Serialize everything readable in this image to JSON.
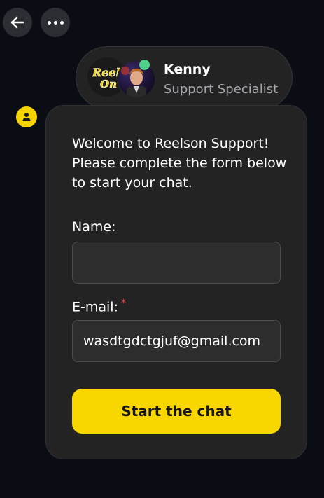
{
  "header": {
    "back_icon": "arrow-left-icon",
    "more_icon": "more-horizontal-icon"
  },
  "agent": {
    "name": "Kenny",
    "role": "Support Specialist",
    "logo_text_line1": "Reels",
    "logo_text_line2": "On",
    "status": "online",
    "status_color": "#4fd18b"
  },
  "chat": {
    "bot_icon": "user-icon",
    "welcome_text": "Welcome to Reelson Support! Please complete the form below to start your chat.",
    "form": {
      "name_label": "Name:",
      "name_value": "",
      "email_label": "E-mail:",
      "email_required_mark": "*",
      "email_value": "wasdtgdctgjuf@gmail.com",
      "submit_label": "Start the chat"
    }
  },
  "colors": {
    "accent": "#f8d700",
    "background": "#0a0e14",
    "card": "#232323"
  }
}
